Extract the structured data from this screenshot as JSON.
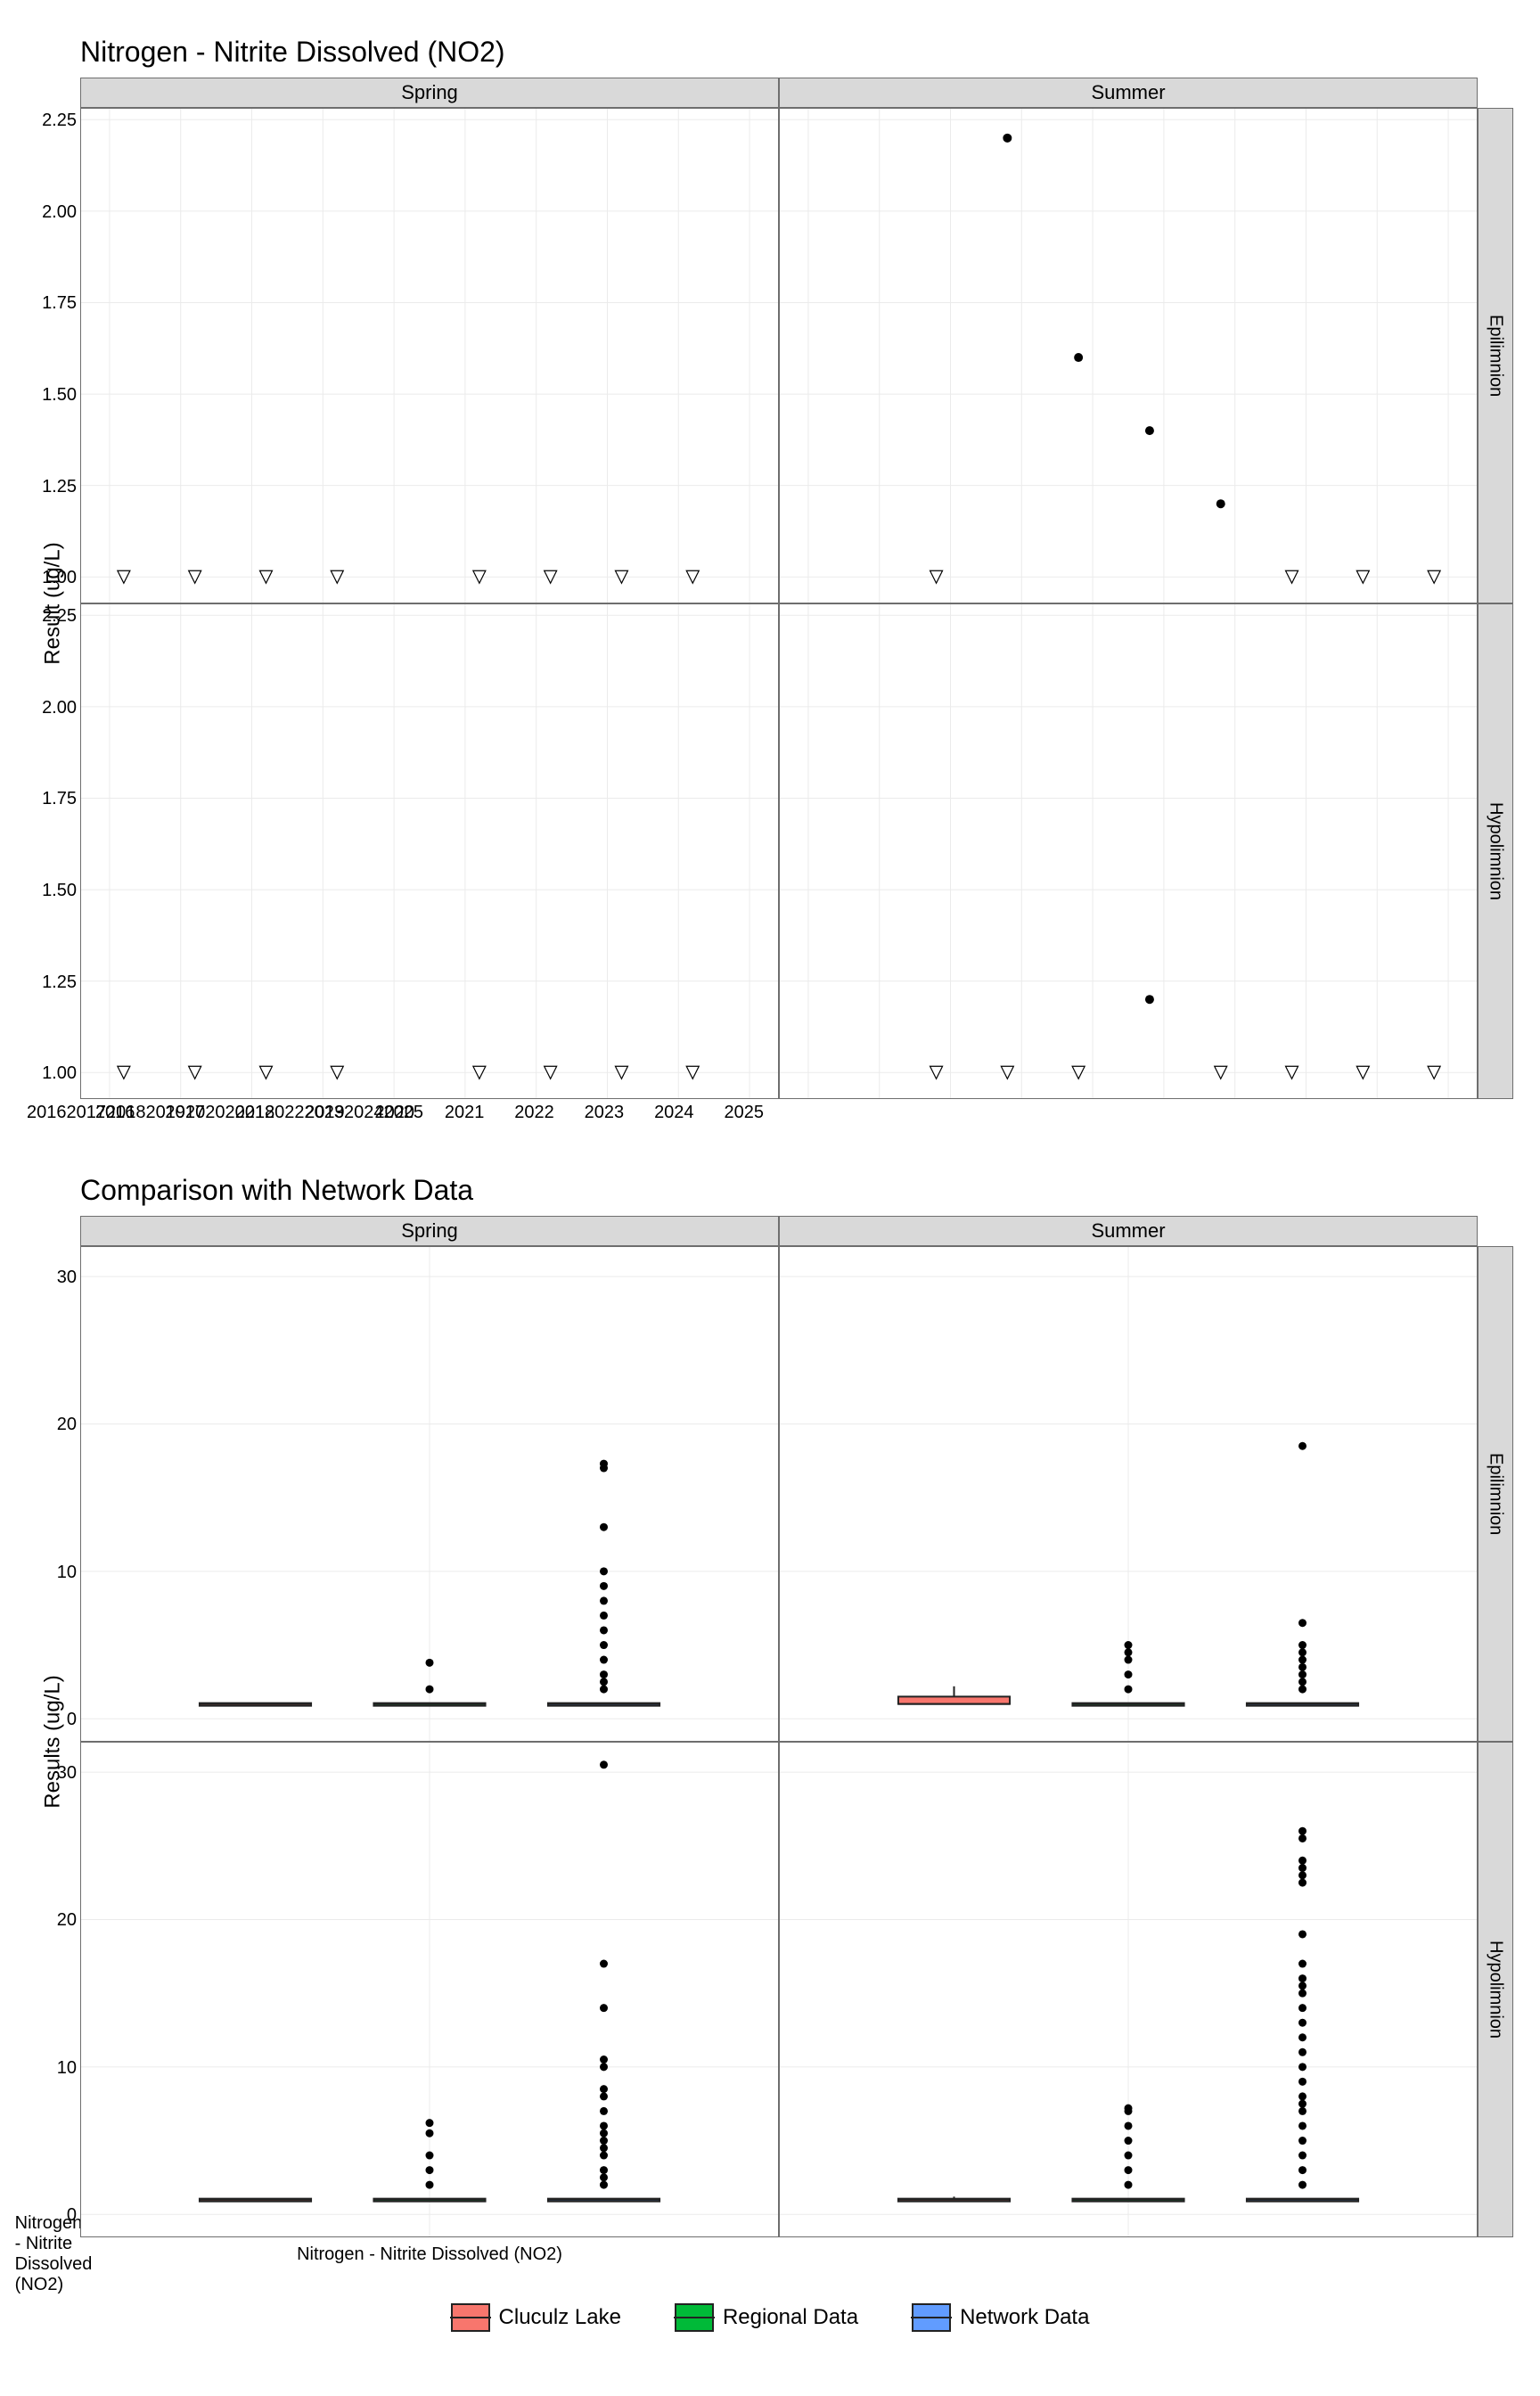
{
  "chart_data": [
    {
      "type": "scatter",
      "title": "Nitrogen - Nitrite Dissolved (NO2)",
      "ylabel": "Result (ug/L)",
      "col_facets": [
        "Spring",
        "Summer"
      ],
      "row_facets": [
        "Epilimnion",
        "Hypolimnion"
      ],
      "x_ticks": [
        2016,
        2017,
        2018,
        2019,
        2020,
        2021,
        2022,
        2023,
        2024,
        2025
      ],
      "y_ticks": [
        1.0,
        1.25,
        1.5,
        1.75,
        2.0,
        2.25
      ],
      "xlim": [
        2015.6,
        2025.4
      ],
      "ylim": [
        0.93,
        2.28
      ],
      "series_note": "open triangles = below detection limit (1.0); filled dots = detections",
      "panels": {
        "Spring|Epilimnion": {
          "triangles": [
            {
              "x": 2016.2,
              "y": 1.0
            },
            {
              "x": 2017.2,
              "y": 1.0
            },
            {
              "x": 2018.2,
              "y": 1.0
            },
            {
              "x": 2019.2,
              "y": 1.0
            },
            {
              "x": 2021.2,
              "y": 1.0
            },
            {
              "x": 2022.2,
              "y": 1.0
            },
            {
              "x": 2023.2,
              "y": 1.0
            },
            {
              "x": 2024.2,
              "y": 1.0
            }
          ],
          "dots": []
        },
        "Summer|Epilimnion": {
          "triangles": [
            {
              "x": 2017.8,
              "y": 1.0
            },
            {
              "x": 2022.8,
              "y": 1.0
            },
            {
              "x": 2023.8,
              "y": 1.0
            },
            {
              "x": 2024.8,
              "y": 1.0
            }
          ],
          "dots": [
            {
              "x": 2018.8,
              "y": 2.2
            },
            {
              "x": 2019.8,
              "y": 1.6
            },
            {
              "x": 2020.8,
              "y": 1.4
            },
            {
              "x": 2021.8,
              "y": 1.2
            }
          ]
        },
        "Spring|Hypolimnion": {
          "triangles": [
            {
              "x": 2016.2,
              "y": 1.0
            },
            {
              "x": 2017.2,
              "y": 1.0
            },
            {
              "x": 2018.2,
              "y": 1.0
            },
            {
              "x": 2019.2,
              "y": 1.0
            },
            {
              "x": 2021.2,
              "y": 1.0
            },
            {
              "x": 2022.2,
              "y": 1.0
            },
            {
              "x": 2023.2,
              "y": 1.0
            },
            {
              "x": 2024.2,
              "y": 1.0
            }
          ],
          "dots": []
        },
        "Summer|Hypolimnion": {
          "triangles": [
            {
              "x": 2017.8,
              "y": 1.0
            },
            {
              "x": 2018.8,
              "y": 1.0
            },
            {
              "x": 2019.8,
              "y": 1.0
            },
            {
              "x": 2021.8,
              "y": 1.0
            },
            {
              "x": 2022.8,
              "y": 1.0
            },
            {
              "x": 2023.8,
              "y": 1.0
            },
            {
              "x": 2024.8,
              "y": 1.0
            }
          ],
          "dots": [
            {
              "x": 2020.8,
              "y": 1.2
            }
          ]
        }
      }
    },
    {
      "type": "boxplot",
      "title": "Comparison with Network Data",
      "ylabel": "Results (ug/L)",
      "col_facets": [
        "Spring",
        "Summer"
      ],
      "row_facets": [
        "Epilimnion",
        "Hypolimnion"
      ],
      "x_category": "Nitrogen - Nitrite Dissolved (NO2)",
      "groups": [
        "Cluculz Lake",
        "Regional Data",
        "Network Data"
      ],
      "group_colors": {
        "Cluculz Lake": "#F8766D",
        "Regional Data": "#00BA38",
        "Network Data": "#619CFF"
      },
      "y_ticks": [
        0,
        10,
        20,
        30
      ],
      "ylim": [
        -1.5,
        32
      ],
      "panels": {
        "Spring|Epilimnion": {
          "boxes": [
            {
              "group": "Cluculz Lake",
              "min": 1.0,
              "q1": 1.0,
              "med": 1.0,
              "q3": 1.0,
              "max": 1.0,
              "outliers": []
            },
            {
              "group": "Regional Data",
              "min": 1.0,
              "q1": 1.0,
              "med": 1.0,
              "q3": 1.0,
              "max": 1.0,
              "outliers": [
                2.0,
                3.8
              ]
            },
            {
              "group": "Network Data",
              "min": 1.0,
              "q1": 1.0,
              "med": 1.0,
              "q3": 1.0,
              "max": 1.0,
              "outliers": [
                2,
                2.5,
                3,
                4,
                5,
                6,
                7,
                8,
                9,
                10,
                13,
                17,
                17.3
              ]
            }
          ]
        },
        "Summer|Epilimnion": {
          "boxes": [
            {
              "group": "Cluculz Lake",
              "min": 1.0,
              "q1": 1.0,
              "med": 1.0,
              "q3": 1.5,
              "max": 2.2,
              "outliers": []
            },
            {
              "group": "Regional Data",
              "min": 1.0,
              "q1": 1.0,
              "med": 1.0,
              "q3": 1.0,
              "max": 1.0,
              "outliers": [
                2,
                3,
                4,
                4.5,
                5
              ]
            },
            {
              "group": "Network Data",
              "min": 1.0,
              "q1": 1.0,
              "med": 1.0,
              "q3": 1.0,
              "max": 1.0,
              "outliers": [
                2,
                2.5,
                3,
                3.5,
                4,
                4.5,
                5,
                6.5,
                18.5
              ]
            }
          ]
        },
        "Spring|Hypolimnion": {
          "boxes": [
            {
              "group": "Cluculz Lake",
              "min": 1.0,
              "q1": 1.0,
              "med": 1.0,
              "q3": 1.0,
              "max": 1.0,
              "outliers": []
            },
            {
              "group": "Regional Data",
              "min": 1.0,
              "q1": 1.0,
              "med": 1.0,
              "q3": 1.0,
              "max": 1.0,
              "outliers": [
                2,
                3,
                4,
                5.5,
                6.2
              ]
            },
            {
              "group": "Network Data",
              "min": 1.0,
              "q1": 1.0,
              "med": 1.0,
              "q3": 1.0,
              "max": 1.0,
              "outliers": [
                2,
                2.5,
                3,
                4,
                4.5,
                5,
                5.5,
                6,
                7,
                8,
                8.5,
                10,
                10.5,
                14,
                17,
                30.5
              ]
            }
          ]
        },
        "Summer|Hypolimnion": {
          "boxes": [
            {
              "group": "Cluculz Lake",
              "min": 1.0,
              "q1": 1.0,
              "med": 1.0,
              "q3": 1.0,
              "max": 1.2,
              "outliers": []
            },
            {
              "group": "Regional Data",
              "min": 1.0,
              "q1": 1.0,
              "med": 1.0,
              "q3": 1.0,
              "max": 1.0,
              "outliers": [
                2,
                3,
                4,
                5,
                6,
                7,
                7.2
              ]
            },
            {
              "group": "Network Data",
              "min": 1.0,
              "q1": 1.0,
              "med": 1.0,
              "q3": 1.0,
              "max": 1.0,
              "outliers": [
                2,
                3,
                4,
                5,
                6,
                7,
                7.5,
                8,
                9,
                10,
                11,
                12,
                13,
                14,
                15,
                15.5,
                16,
                17,
                19,
                22.5,
                23,
                23.5,
                24,
                25.5,
                26
              ]
            }
          ]
        }
      }
    }
  ],
  "legend": {
    "items": [
      {
        "label": "Cluculz Lake",
        "color": "#F8766D"
      },
      {
        "label": "Regional Data",
        "color": "#00BA38"
      },
      {
        "label": "Network Data",
        "color": "#619CFF"
      }
    ]
  }
}
